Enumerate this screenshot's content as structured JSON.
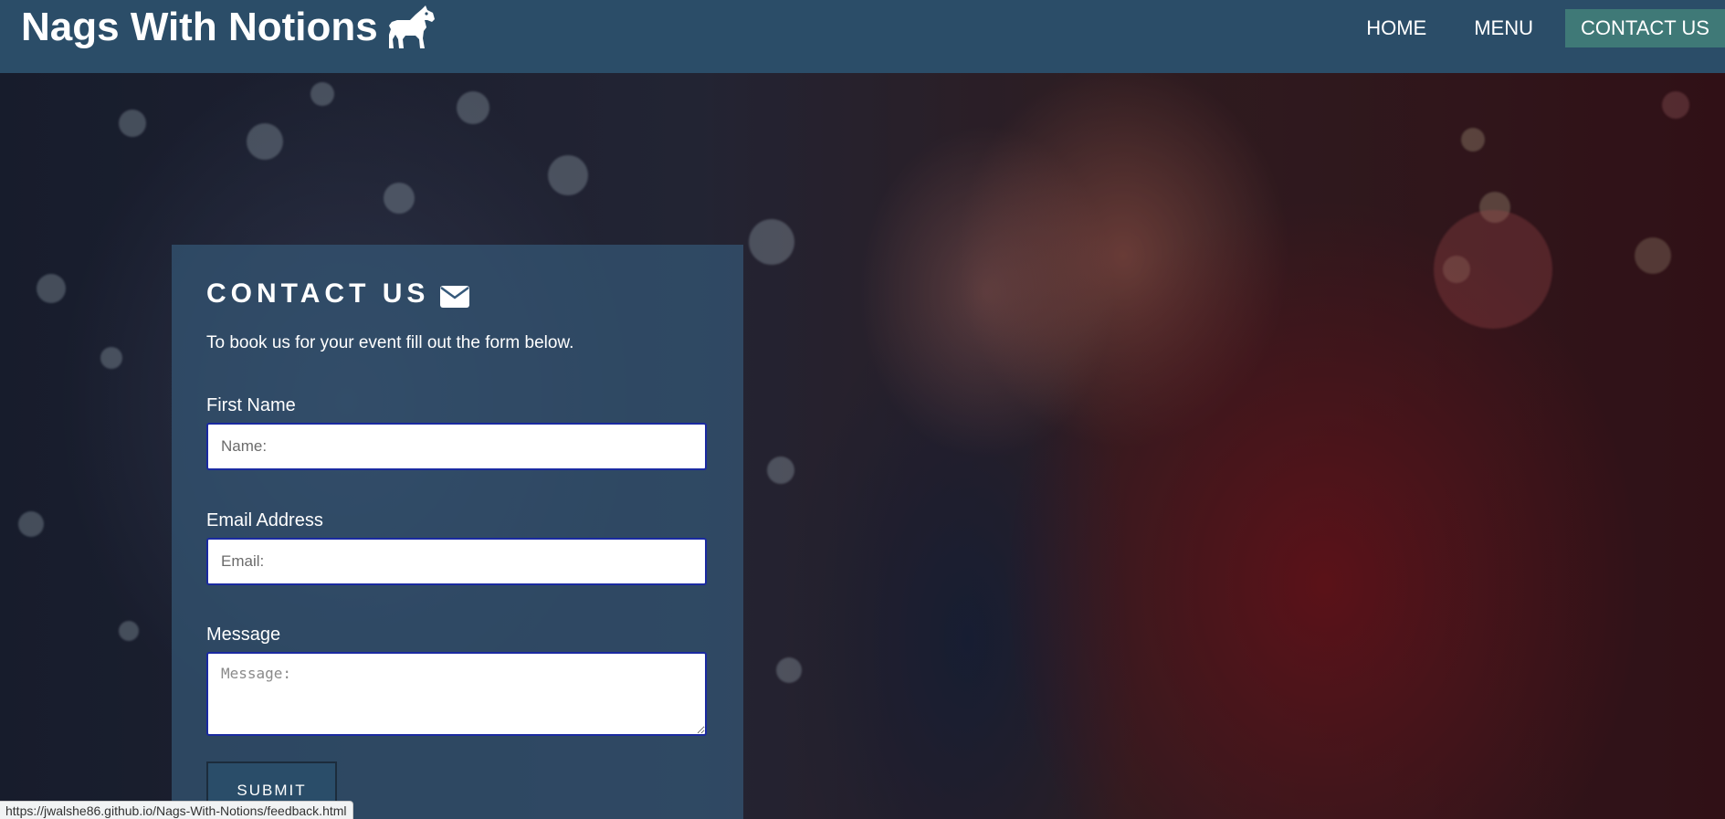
{
  "header": {
    "brand": "Nags With Notions",
    "logo_icon": "horse-icon",
    "nav": [
      {
        "label": "HOME"
      },
      {
        "label": "MENU"
      },
      {
        "label": "CONTACT US"
      }
    ],
    "active_nav": "CONTACT US",
    "background_color": "#2b4d68",
    "active_color": "#3f7977"
  },
  "contact": {
    "title": "CONTACT US",
    "title_icon": "envelope-icon",
    "intro": "To book us for your event fill out the form below.",
    "fields": {
      "first_name": {
        "label": "First Name",
        "placeholder": "Name:",
        "value": ""
      },
      "email": {
        "label": "Email Address",
        "placeholder": "Email:",
        "value": ""
      },
      "message": {
        "label": "Message",
        "placeholder": "Message:",
        "value": ""
      }
    },
    "submit_label": "SUBMIT"
  },
  "status_bar": {
    "url": "https://jwalshe86.github.io/Nags-With-Notions/feedback.html"
  }
}
